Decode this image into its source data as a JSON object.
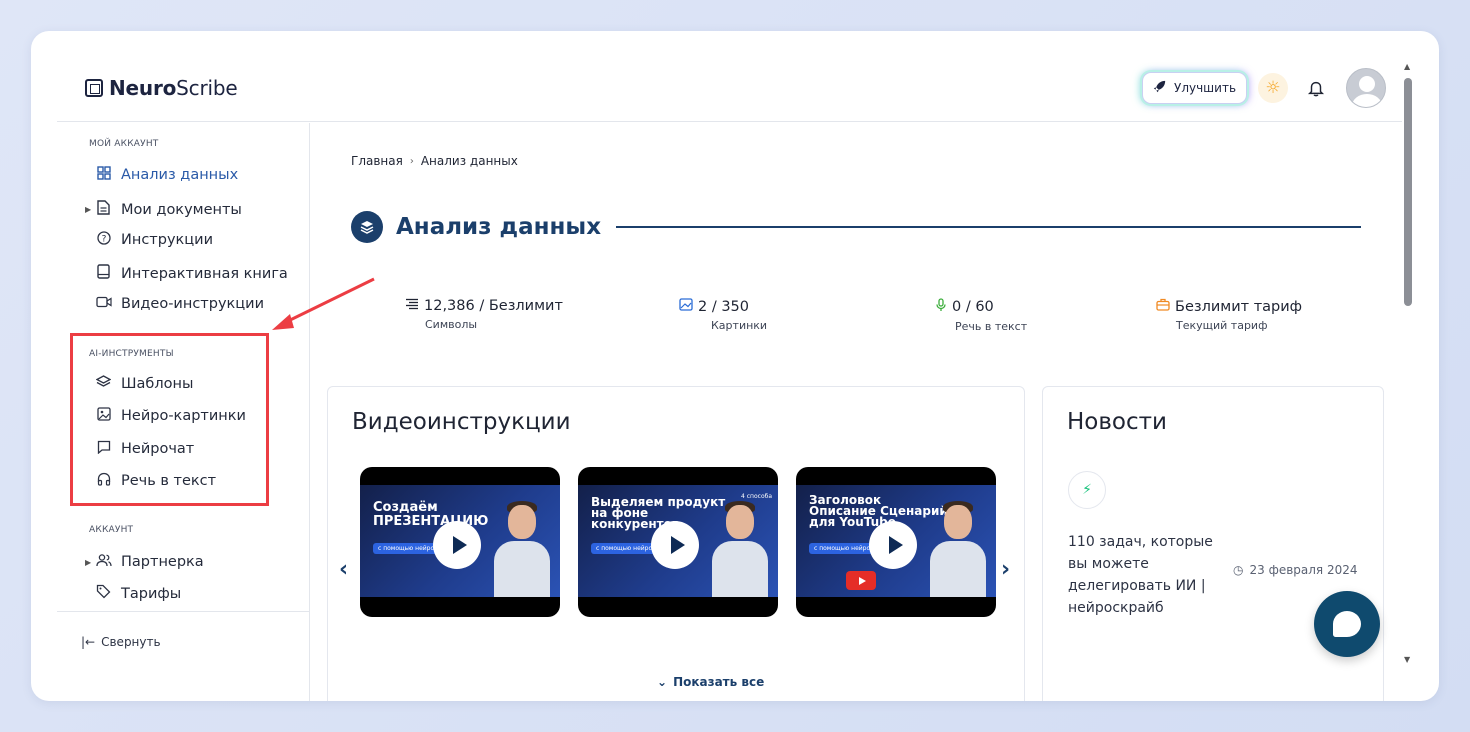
{
  "app": {
    "logo_bold": "Neuro",
    "logo_regular": "Scribe",
    "upgrade_label": "Улучшить"
  },
  "sidebar": {
    "sections": [
      {
        "title": "МОЙ АККАУНТ"
      },
      {
        "title": "AI-ИНСТРУМЕНТЫ"
      },
      {
        "title": "АККАУНТ"
      }
    ],
    "items": [
      {
        "label": "Анализ данных",
        "icon": "grid-icon"
      },
      {
        "label": "Мои документы",
        "icon": "document-icon"
      },
      {
        "label": "Инструкции",
        "icon": "help-circle-icon"
      },
      {
        "label": "Интерактивная книга",
        "icon": "book-icon"
      },
      {
        "label": "Видео-инструкции",
        "icon": "video-icon"
      },
      {
        "label": "Шаблоны",
        "icon": "layers-icon"
      },
      {
        "label": "Нейро-картинки",
        "icon": "image-icon"
      },
      {
        "label": "Нейрочат",
        "icon": "chat-icon"
      },
      {
        "label": "Речь в текст",
        "icon": "headphones-icon"
      },
      {
        "label": "Партнерка",
        "icon": "users-icon"
      },
      {
        "label": "Тарифы",
        "icon": "tag-icon"
      }
    ],
    "collapse_label": "Свернуть"
  },
  "breadcrumb": {
    "home": "Главная",
    "current": "Анализ данных"
  },
  "page_title": "Анализ данных",
  "stats": [
    {
      "value": "12,386 / Безлимит",
      "label": "Символы",
      "icon": "text-lines-icon",
      "color": "#1f2433"
    },
    {
      "value": "2 / 350",
      "label": "Картинки",
      "icon": "image-icon",
      "color": "#2a6cd6"
    },
    {
      "value": "0 / 60",
      "label": "Речь в текст",
      "icon": "microphone-icon",
      "color": "#3cae3c"
    },
    {
      "value": "Безлимит тариф",
      "label": "Текущий тариф",
      "icon": "briefcase-icon",
      "color": "#f08a24"
    }
  ],
  "videos": {
    "title": "Видеоинструкции",
    "items": [
      {
        "heading": "Создаём ПРЕЗЕНТАЦИЮ",
        "tag": "с помощью нейросети"
      },
      {
        "heading": "Выделяем продукт на фоне конкурентов",
        "tag": "с помощью нейросети",
        "corner": "4 способа"
      },
      {
        "heading": "Заголовок Описание Сценарий для YouTube",
        "tag": "с помощью нейросети"
      }
    ],
    "show_all": "Показать все"
  },
  "news": {
    "title": "Новости",
    "item_text": "110 задач, которые вы можете делегировать ИИ | нейроскрайб",
    "item_date": "23 февраля 2024"
  },
  "colors": {
    "accent": "#1b3f6b",
    "highlight": "#ec3d43"
  }
}
